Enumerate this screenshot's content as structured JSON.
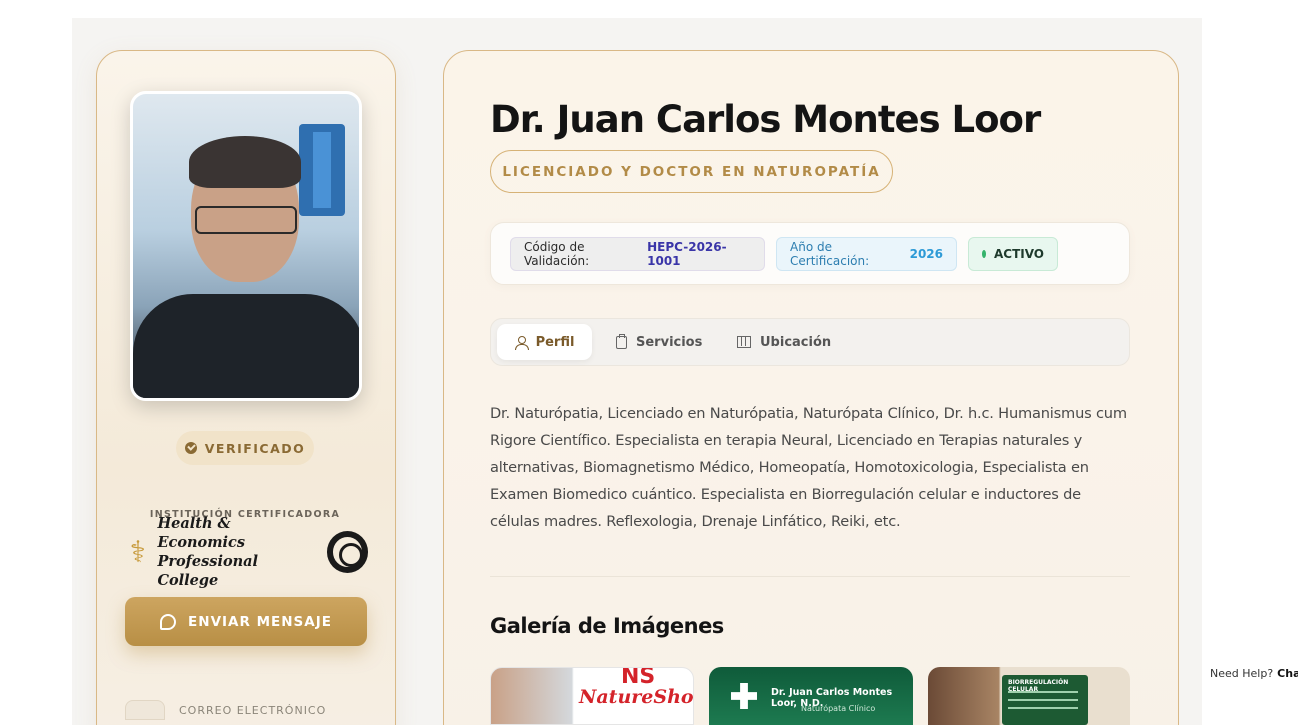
{
  "profile": {
    "name": "Dr. Juan Carlos Montes Loor",
    "title": "LICENCIADO Y DOCTOR EN NATUROPATÍA",
    "verified_label": "VERIFICADO",
    "institution_label": "INSTITUCIÓN CERTIFICADORA",
    "institution_name_line1": "Health & Economics",
    "institution_name_line2": "Professional College",
    "send_message_label": "ENVIAR MENSAJE",
    "contact_email_label": "CORREO ELECTRÓNICO"
  },
  "meta": {
    "code_label": "Código de Validación:",
    "code_value": "HEPC-2026-1001",
    "year_label": "Año de Certificación:",
    "year_value": "2026",
    "status": "ACTIVO"
  },
  "tabs": [
    {
      "label": "Perfil",
      "icon": "user-icon",
      "active": true
    },
    {
      "label": "Servicios",
      "icon": "clipboard-icon",
      "active": false
    },
    {
      "label": "Ubicación",
      "icon": "map-icon",
      "active": false
    }
  ],
  "bio": "Dr. Naturópatia, Licenciado en Naturópatia, Naturópata Clínico, Dr. h.c. Humanismus cum Rigore Científico. Especialista en terapia Neural, Licenciado en Terapias naturales y alternativas, Biomagnetismo Médico, Homeopatía, Homotoxicologia, Especialista en Examen Biomedico cuántico. Especialista en Biorregulación celular e inductores de células madres. Reflexologia, Drenaje Linfático, Reiki, etc.",
  "gallery": {
    "title": "Galería de Imágenes",
    "items": [
      {
        "brand": "NatureShop",
        "brand_top": "NS"
      },
      {
        "caption": "Dr. Juan Carlos Montes Loor, N.D.",
        "subcaption": "Naturópata Clínico"
      },
      {
        "caption": "BIORREGULACIÓN CELULAR"
      }
    ]
  },
  "help_widget": {
    "text": "Need Help?",
    "bold": "Chat"
  },
  "colors": {
    "accent_gold": "#b88f45",
    "code_value": "#3a35a8",
    "year_value": "#2d9ad6",
    "status_dot": "#34b36b"
  }
}
